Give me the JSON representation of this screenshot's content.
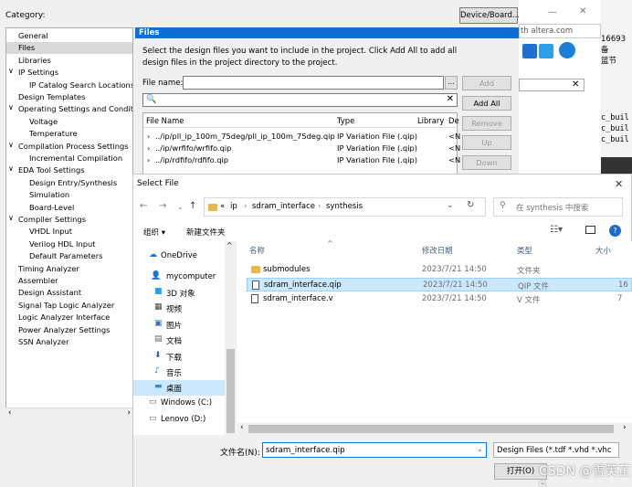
{
  "category_label": "Category:",
  "device_board_button": "Device/Board...",
  "tree": [
    {
      "label": "General",
      "indent": 0
    },
    {
      "label": "Files",
      "indent": 0,
      "selected": true
    },
    {
      "label": "Libraries",
      "indent": 0
    },
    {
      "label": "IP Settings",
      "indent": 0,
      "expanded": true
    },
    {
      "label": "IP Catalog Search Locations",
      "indent": 2
    },
    {
      "label": "Design Templates",
      "indent": 0
    },
    {
      "label": "Operating Settings and Conditi",
      "indent": 0,
      "expanded": true
    },
    {
      "label": "Voltage",
      "indent": 2
    },
    {
      "label": "Temperature",
      "indent": 2
    },
    {
      "label": "Compilation Process Settings",
      "indent": 0,
      "expanded": true
    },
    {
      "label": "Incremental Compilation",
      "indent": 2
    },
    {
      "label": "EDA Tool Settings",
      "indent": 0,
      "expanded": true
    },
    {
      "label": "Design Entry/Synthesis",
      "indent": 2
    },
    {
      "label": "Simulation",
      "indent": 2
    },
    {
      "label": "Board-Level",
      "indent": 2
    },
    {
      "label": "Compiler Settings",
      "indent": 0,
      "expanded": true
    },
    {
      "label": "VHDL Input",
      "indent": 2
    },
    {
      "label": "Verilog HDL Input",
      "indent": 2
    },
    {
      "label": "Default Parameters",
      "indent": 2
    },
    {
      "label": "Timing Analyzer",
      "indent": 0
    },
    {
      "label": "Assembler",
      "indent": 0
    },
    {
      "label": "Design Assistant",
      "indent": 0
    },
    {
      "label": "Signal Tap Logic Analyzer",
      "indent": 0
    },
    {
      "label": "Logic Analyzer Interface",
      "indent": 0
    },
    {
      "label": "Power Analyzer Settings",
      "indent": 0
    },
    {
      "label": "SSN Analyzer",
      "indent": 0
    }
  ],
  "files_panel": {
    "header": "Files",
    "description": "Select the design files you want to include in the project. Click Add All to add all design files in the project directory to the project.",
    "file_name_label": "File name:",
    "browse": "...",
    "buttons": {
      "add": "Add",
      "add_all": "Add All",
      "remove": "Remove",
      "up": "Up",
      "down": "Down"
    },
    "columns": [
      "File Name",
      "Type",
      "Library",
      "De"
    ],
    "rows": [
      {
        "name": "../ip/pll_ip_100m_75deg/pll_ip_100m_75deg.qip",
        "type": "IP Variation File (.qip)",
        "lib": "<N"
      },
      {
        "name": "../ip/wrfifo/wrfifo.qip",
        "type": "IP Variation File (.qip)",
        "lib": "<N"
      },
      {
        "name": "../ip/rdfifo/rdfifo.qip",
        "type": "IP Variation File (.qip)",
        "lib": "<N"
      }
    ]
  },
  "background": {
    "url_fragment": "th altera.com",
    "num": "16693 备",
    "node": "篮节",
    "code_lines": [
      "c_buil",
      "c_buil",
      "c_buil"
    ]
  },
  "dialog": {
    "title": "Select File",
    "close": "✕",
    "breadcrumb": [
      "«",
      "ip",
      "sdram_interface",
      "synthesis"
    ],
    "search_placeholder": "在 synthesis 中搜索",
    "organize": "组织 ▾",
    "new_folder": "新建文件夹",
    "nav": [
      {
        "label": "OneDrive",
        "icon": "cloud-icon"
      },
      {
        "label": "mycomputer",
        "icon": "person-icon"
      },
      {
        "label": "3D 对象",
        "icon": "cube-icon"
      },
      {
        "label": "视频",
        "icon": "video-icon"
      },
      {
        "label": "图片",
        "icon": "picture-icon"
      },
      {
        "label": "文档",
        "icon": "document-icon"
      },
      {
        "label": "下载",
        "icon": "download-icon"
      },
      {
        "label": "音乐",
        "icon": "music-icon"
      },
      {
        "label": "桌面",
        "icon": "desktop-icon",
        "selected": true
      },
      {
        "label": "Windows (C:)",
        "icon": "drive-icon"
      },
      {
        "label": "Lenovo (D:)",
        "icon": "drive-icon"
      }
    ],
    "columns": [
      "名称",
      "修改日期",
      "类型",
      "大小"
    ],
    "files": [
      {
        "name": "submodules",
        "date": "2023/7/21 14:50",
        "type": "文件夹",
        "size": "",
        "kind": "folder"
      },
      {
        "name": "sdram_interface.qip",
        "date": "2023/7/21 14:50",
        "type": "QIP 文件",
        "size": "16",
        "kind": "file",
        "selected": true
      },
      {
        "name": "sdram_interface.v",
        "date": "2023/7/21 14:50",
        "type": "V 文件",
        "size": "7",
        "kind": "file"
      }
    ],
    "file_name_label": "文件名(N):",
    "file_name_value": "sdram_interface.qip",
    "file_type": "Design Files (*.tdf *.vhd *.vhc",
    "open_button": "打开(O)",
    "watermark": "CSDN @雪芙芷S"
  }
}
